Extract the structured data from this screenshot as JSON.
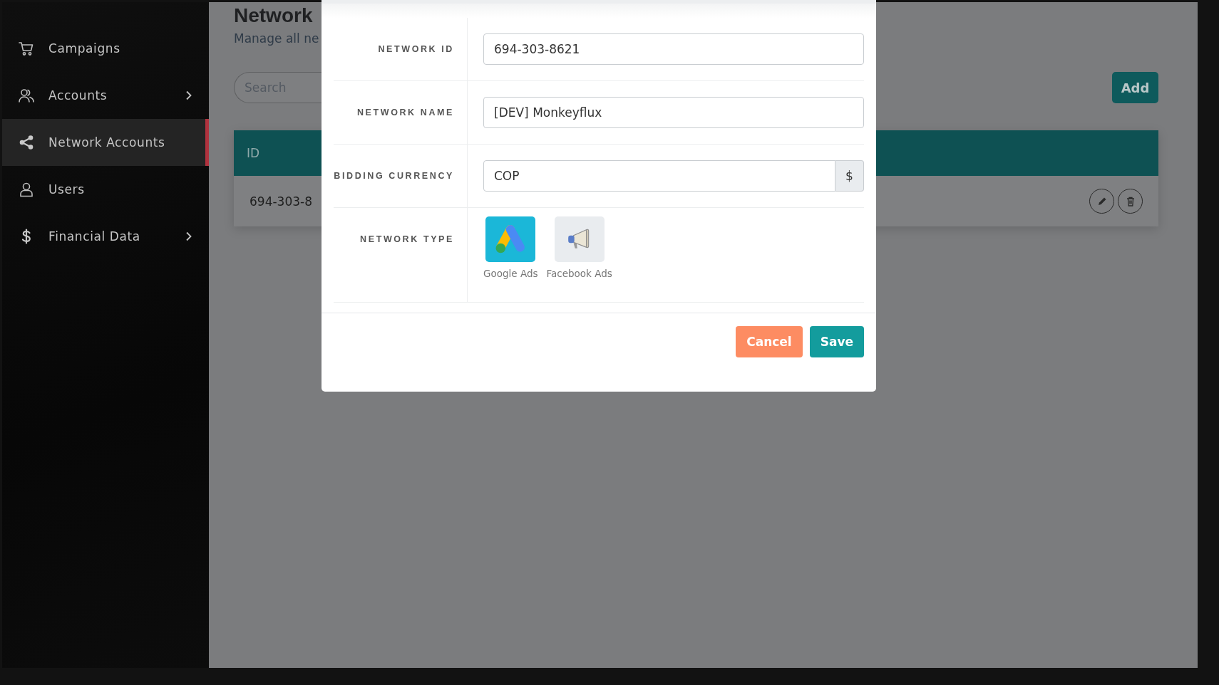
{
  "sidebar": {
    "items": [
      {
        "label": "Campaigns",
        "kind": "cart",
        "expandable": false,
        "selected": false
      },
      {
        "label": "Accounts",
        "kind": "users",
        "expandable": true,
        "selected": false
      },
      {
        "label": "Network Accounts",
        "kind": "share",
        "expandable": false,
        "selected": true
      },
      {
        "label": "Users",
        "kind": "user",
        "expandable": false,
        "selected": false
      },
      {
        "label": "Financial Data",
        "kind": "dollar",
        "expandable": true,
        "selected": false
      }
    ]
  },
  "page": {
    "title": "Network",
    "subtitle": "Manage all ne",
    "search": {
      "placeholder": "Search"
    },
    "add_button": "Add",
    "table": {
      "columns": [
        "ID"
      ],
      "rows": [
        {
          "id": "694-303-8"
        }
      ]
    }
  },
  "modal": {
    "fields": [
      {
        "kind": "text",
        "label": "NETWORK ID",
        "value": "694-303-8621"
      },
      {
        "kind": "text",
        "label": "NETWORK NAME",
        "value": "[DEV] Monkeyflux"
      },
      {
        "kind": "addon",
        "label": "BIDDING CURRENCY",
        "value": "COP",
        "addon": "$"
      },
      {
        "kind": "types",
        "label": "NETWORK TYPE",
        "options": [
          {
            "label": "Google Ads",
            "kind": "google",
            "selected": true
          },
          {
            "label": "Facebook Ads",
            "kind": "megaphone",
            "selected": false
          }
        ]
      }
    ],
    "buttons": [
      {
        "kind": "cancel",
        "label": "Cancel"
      },
      {
        "kind": "save",
        "label": "Save"
      }
    ]
  }
}
